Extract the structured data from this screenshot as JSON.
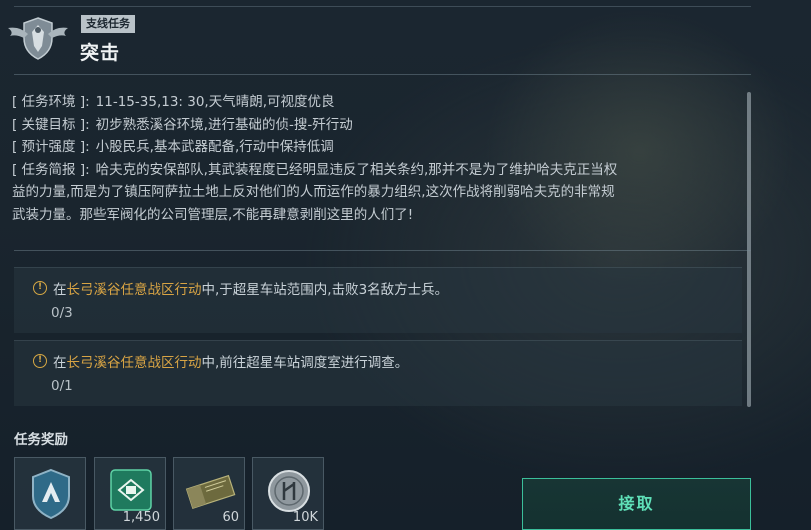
{
  "header": {
    "tag": "支线任务",
    "title": "突击"
  },
  "info": {
    "env_label": "[ 任务环境 ]:",
    "env_value": "11-15-35,13: 30,天气晴朗,可视度优良",
    "target_label": "[ 关键目标 ]:",
    "target_value": "初步熟悉溪谷环境,进行基础的侦-搜-歼行动",
    "strength_label": "[ 预计强度 ]:",
    "strength_value": "小股民兵,基本武器配备,行动中保持低调",
    "brief_label": "[ 任务简报 ]:",
    "brief_line1": "哈夫克的安保部队,其武装程度已经明显违反了相关条约,那并不是为了维护哈夫克正当权",
    "brief_line2": "益的力量,而是为了镇压阿萨拉土地上反对他们的人而运作的暴力组织,这次作战将削弱哈夫克的非常规",
    "brief_line3": "武装力量。那些军阀化的公司管理层,不能再肆意剥削这里的人们了!"
  },
  "objectives": [
    {
      "prefix": "在",
      "highlight": "长弓溪谷任意战区行动",
      "suffix": "中,于超星车站范围内,击败3名敌方士兵。",
      "progress": "0/3"
    },
    {
      "prefix": "在",
      "highlight": "长弓溪谷任意战区行动",
      "suffix": "中,前往超星车站调度室进行调查。",
      "progress": "0/1"
    }
  ],
  "rewards": {
    "label": "任务奖励",
    "items": [
      {
        "icon": "badge-icon",
        "amount": ""
      },
      {
        "icon": "crate-icon",
        "amount": "1,450"
      },
      {
        "icon": "ammo-box-icon",
        "amount": "60"
      },
      {
        "icon": "coin-icon",
        "amount": "10K"
      }
    ]
  },
  "accept_button": "接取",
  "colors": {
    "accent": "#3bbf9a",
    "highlight": "#d8a444",
    "tag_bg": "#b9c2c8"
  }
}
